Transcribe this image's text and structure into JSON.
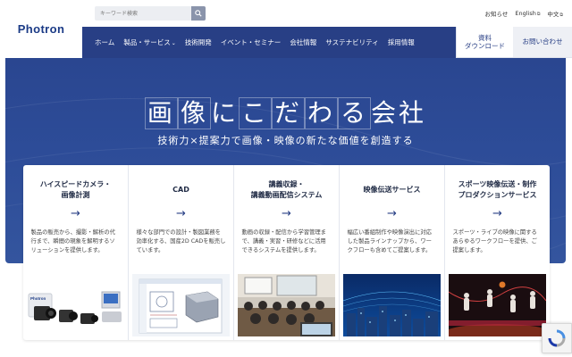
{
  "header": {
    "logo": "Photron",
    "search": {
      "placeholder": "キーワード検索"
    },
    "top_links": [
      "お知らせ",
      "English",
      "中文"
    ],
    "nav": [
      "ホーム",
      "製品・サービス",
      "技術開発",
      "イベント・セミナー",
      "会社情報",
      "サステナビリティ",
      "採用情報"
    ],
    "cta_catalog": "資料\nダウンロード",
    "cta_contact": "お問い合わせ"
  },
  "hero": {
    "headline_chars": [
      "画",
      "像",
      "に",
      "こ",
      "だ",
      "わ",
      "る",
      "会",
      "社"
    ],
    "subline": "技術力×提案力で画像・映像の新たな価値を創造する"
  },
  "cards": [
    {
      "title": "ハイスピードカメラ・\n画像計測",
      "desc": "製品の販売から、撮影・解析の代行まで、瞬間の現象を解明するソリューションを提供します。",
      "image": "camera-products"
    },
    {
      "title": "CAD",
      "desc": "様々な部門での設計・製図業務を効率化する、国産2D CADを販売しています。",
      "image": "cad-software"
    },
    {
      "title": "講義収録・\n講義動画配信システム",
      "desc": "動画の収録・配信から学習管理まで、講義・実習・研修などに活用できるシステムを提供します。",
      "image": "lecture-classroom"
    },
    {
      "title": "映像伝送サービス",
      "desc": "幅広い番組制作や映像演出に対応した製品ラインナップから、ワークフローも含めてご提案します。",
      "image": "city-network"
    },
    {
      "title": "スポーツ映像伝送・制作\nプロダクションサービス",
      "desc": "スポーツ・ライブの映像に関するあらゆるワークフローを提供、ご提案します。",
      "image": "sports-basketball"
    }
  ],
  "colors": {
    "brand": "#283f85",
    "hero": "#2d4c98"
  }
}
